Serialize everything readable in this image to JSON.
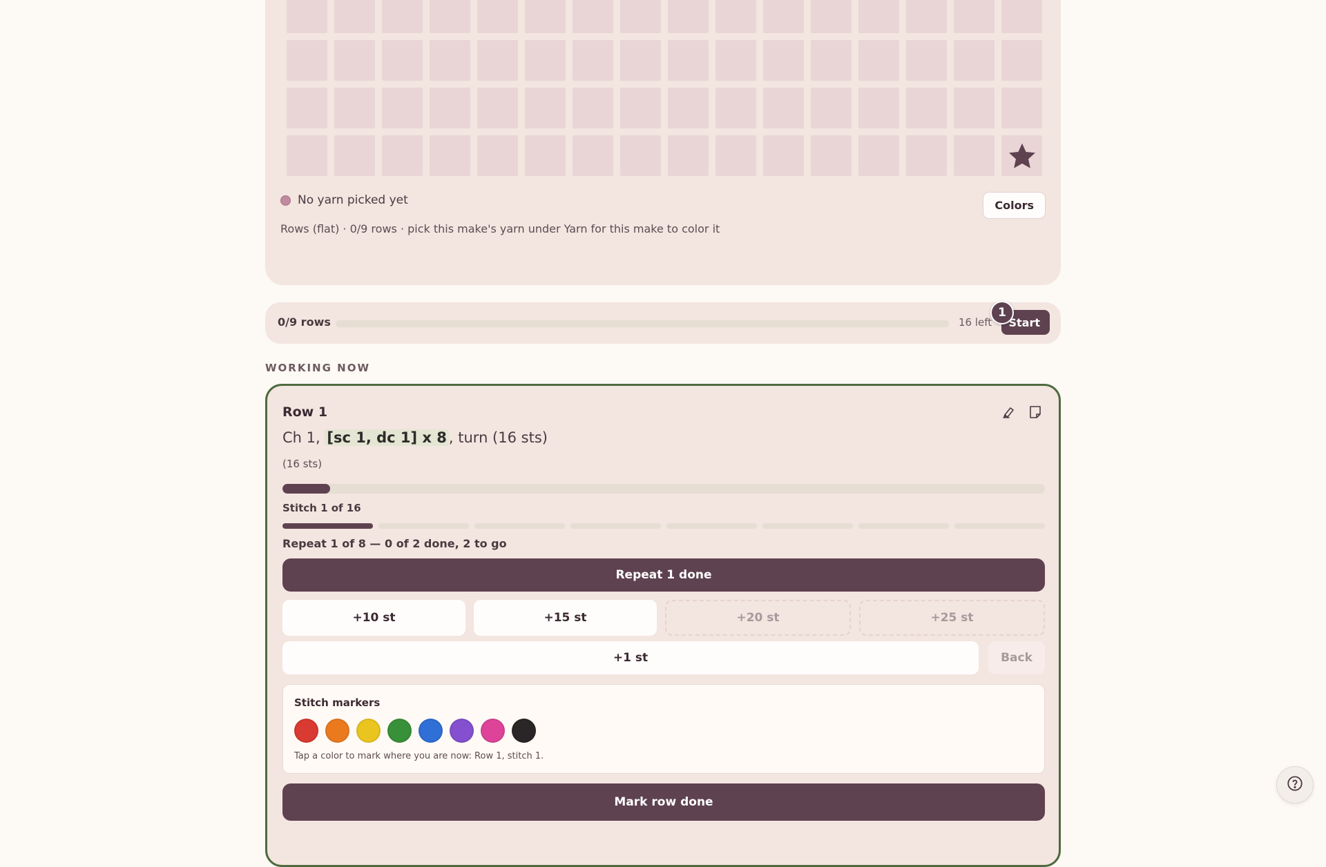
{
  "chart": {
    "columns": 16,
    "rows_visible": 5,
    "active_cell_icon": "star-icon",
    "yarn_status": "No yarn picked yet",
    "colors_button": "Colors",
    "caption": "Rows (flat) · 0/9 rows · pick this make's yarn under Yarn for this make to color it"
  },
  "progress": {
    "label": "0/9 rows",
    "fraction": 0,
    "left_text": "16 left",
    "start_button": "Start",
    "badge": "1"
  },
  "section_label": "WORKING NOW",
  "work": {
    "row_title": "Row 1",
    "tools": [
      "highlighter-icon",
      "note-icon"
    ],
    "instruction": {
      "prefix": "Ch 1, ",
      "highlight": "[sc 1, dc 1] x 8",
      "suffix": ", turn (16 sts)"
    },
    "stitch_count": "(16 sts)",
    "row_fraction": 0.0625,
    "stitch_label": "Stitch 1 of 16",
    "segments_total": 8,
    "segments_active": 1,
    "repeat_label": "Repeat 1 of 8 — 0 of 2 done, 2 to go",
    "repeat_button": "Repeat 1 done",
    "increments": [
      {
        "label": "+10 st",
        "enabled": true
      },
      {
        "label": "+15 st",
        "enabled": true
      },
      {
        "label": "+20 st",
        "enabled": false
      },
      {
        "label": "+25 st",
        "enabled": false
      }
    ],
    "plus_one": "+1 st",
    "back": "Back",
    "markers": {
      "title": "Stitch markers",
      "colors": [
        "#d93a31",
        "#eb7a1f",
        "#eac51f",
        "#389138",
        "#2f6fd6",
        "#8450cf",
        "#dd4499",
        "#2a2526"
      ],
      "hint": "Tap a color to mark where you are now: Row 1, stitch 1."
    },
    "mark_row_button": "Mark row done"
  },
  "help": {
    "icon": "help-icon"
  },
  "colors": {
    "accent": "#5e424f",
    "card_border": "#4e6a3e",
    "panel": "#f3e5e0",
    "cell": "#e9d5d6"
  }
}
